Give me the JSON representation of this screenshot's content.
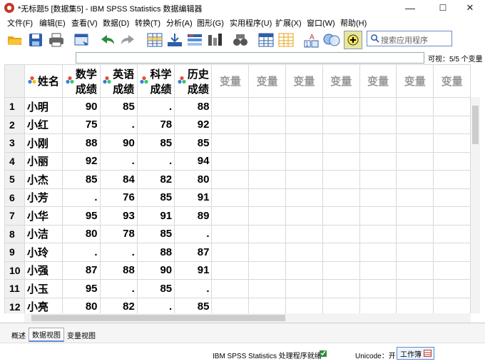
{
  "window": {
    "title": "*无标题5 [数据集5] - IBM SPSS Statistics 数据编辑器",
    "minimize": "—",
    "maximize": "☐",
    "close": "✕"
  },
  "menu": [
    "文件(F)",
    "编辑(E)",
    "查看(V)",
    "数据(D)",
    "转换(T)",
    "分析(A)",
    "图形(G)",
    "实用程序(U)",
    "扩展(X)",
    "窗口(W)",
    "帮助(H)"
  ],
  "toolbar": {
    "search_placeholder": "搜索应用程序",
    "icons": [
      "open-icon",
      "save-icon",
      "print-icon",
      "dialog-recall-icon",
      "undo-icon",
      "redo-icon",
      "goto-case-icon",
      "goto-variable-icon",
      "variables-icon",
      "run-descriptives-icon",
      "find-icon",
      "insert-cases-icon",
      "insert-variable-icon",
      "split-file-icon",
      "weight-cases-icon",
      "value-labels-icon",
      "use-sets-icon"
    ]
  },
  "cellbar": {
    "visible": "可视：5/5 个变量"
  },
  "grid": {
    "columns": [
      {
        "l1": "姓名",
        "l2": "",
        "type": "nominal"
      },
      {
        "l1": "数学",
        "l2": "成绩",
        "type": "scale"
      },
      {
        "l1": "英语",
        "l2": "成绩",
        "type": "scale"
      },
      {
        "l1": "科学",
        "l2": "成绩",
        "type": "scale"
      },
      {
        "l1": "历史",
        "l2": "成绩",
        "type": "scale"
      }
    ],
    "empty_header": "变量",
    "empty_cols": 7,
    "rows": [
      [
        "1",
        "小明",
        "90",
        "85",
        ".",
        "88"
      ],
      [
        "2",
        "小红",
        "75",
        ".",
        "78",
        "92"
      ],
      [
        "3",
        "小刚",
        "88",
        "90",
        "85",
        "85"
      ],
      [
        "4",
        "小丽",
        "92",
        ".",
        ".",
        "94"
      ],
      [
        "5",
        "小杰",
        "85",
        "84",
        "82",
        "80"
      ],
      [
        "6",
        "小芳",
        ".",
        "76",
        "85",
        "91"
      ],
      [
        "7",
        "小华",
        "95",
        "93",
        "91",
        "89"
      ],
      [
        "8",
        "小洁",
        "80",
        "78",
        "85",
        "."
      ],
      [
        "9",
        "小玲",
        ".",
        ".",
        "88",
        "87"
      ],
      [
        "10",
        "小强",
        "87",
        "88",
        "90",
        "91"
      ],
      [
        "11",
        "小玉",
        "95",
        ".",
        "85",
        "."
      ],
      [
        "12",
        "小亮",
        "80",
        "82",
        ".",
        "85"
      ]
    ]
  },
  "tabs": [
    "概述",
    "数据视图",
    "变量视图"
  ],
  "status": {
    "processor": "IBM SPSS Statistics 处理程序就绪",
    "unicode": "Unicode：开",
    "workbook": "工作簿"
  }
}
